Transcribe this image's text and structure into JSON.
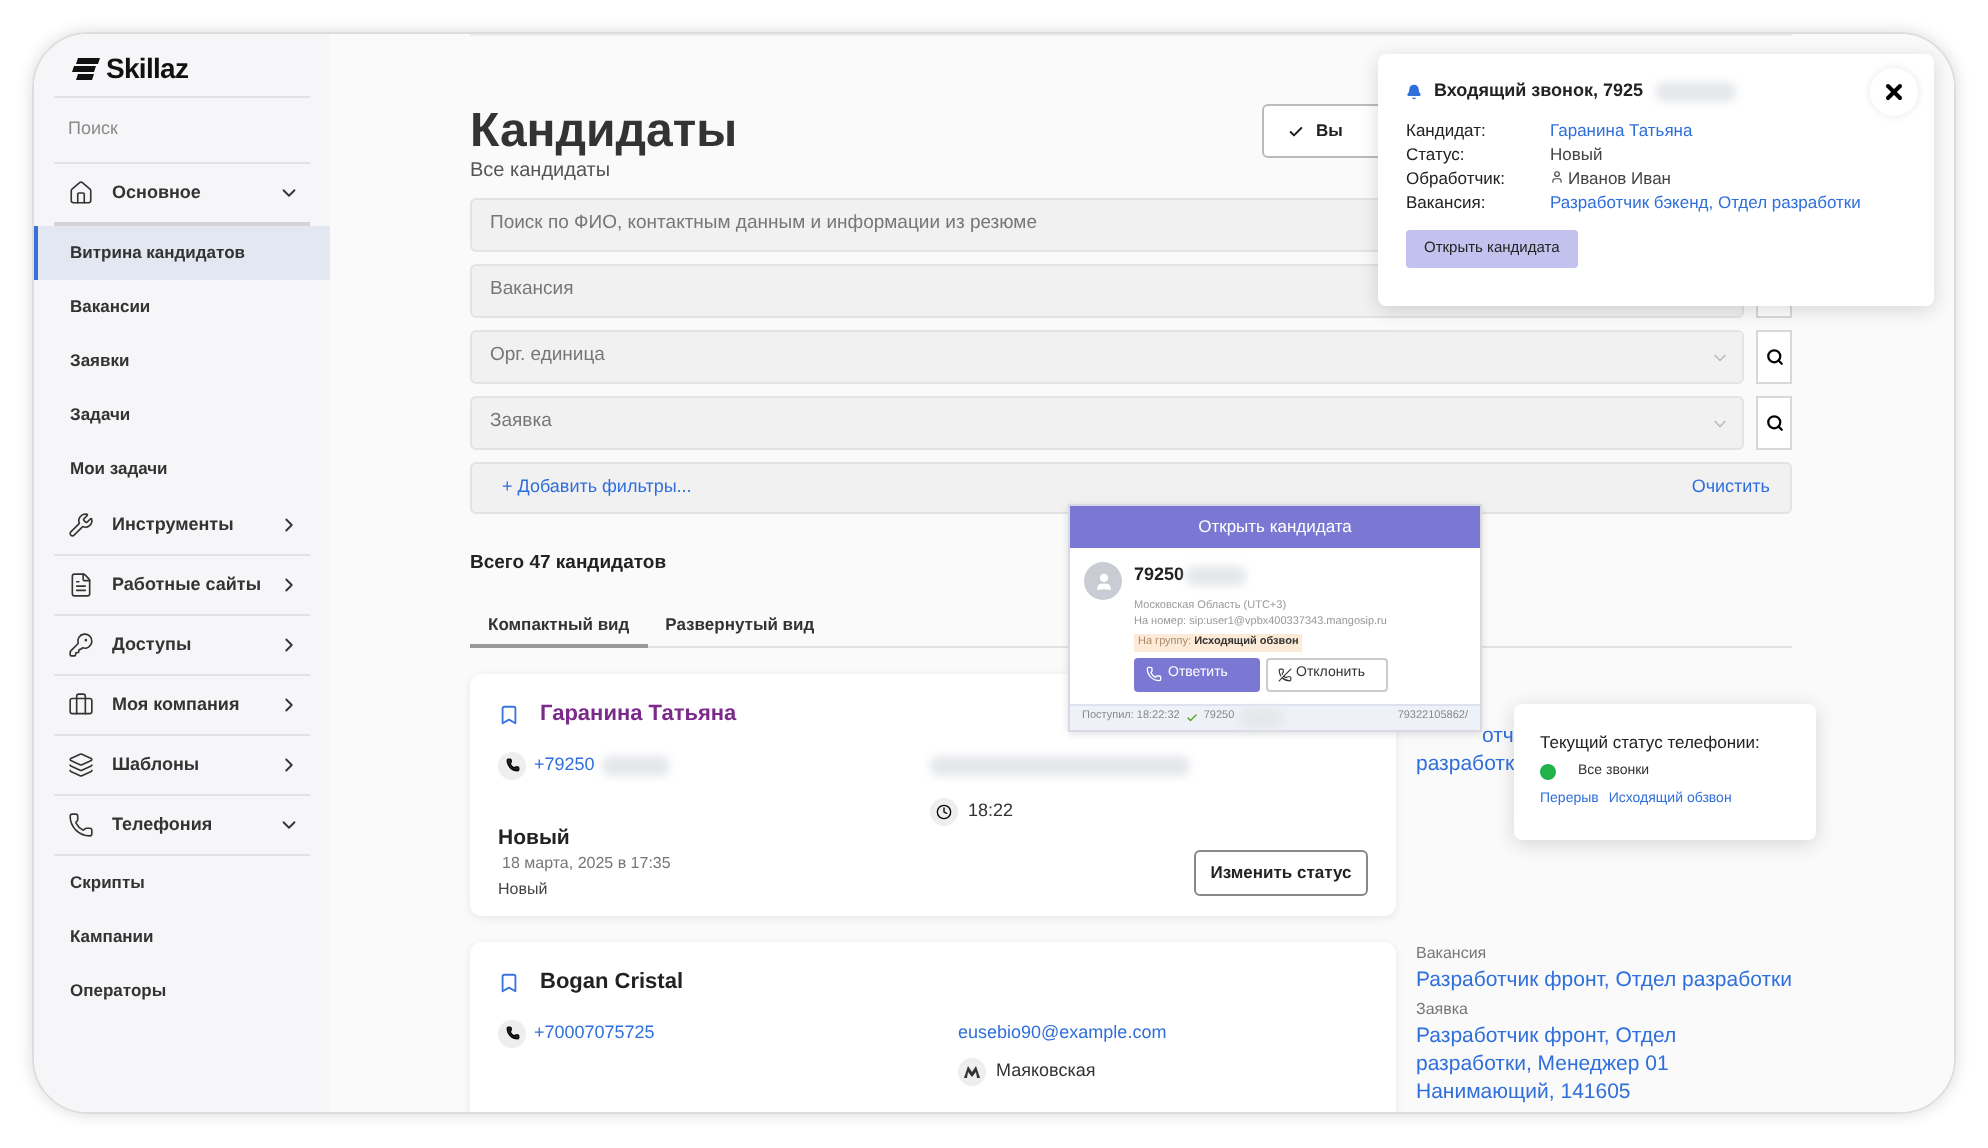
{
  "app": {
    "logo": "Skillaz"
  },
  "sidebar": {
    "search_label": "Поиск",
    "groups": [
      {
        "label": "Основное",
        "expanded": true,
        "children": [
          {
            "label": "Витрина кандидатов",
            "selected": true
          },
          {
            "label": "Вакансии",
            "selected": false
          },
          {
            "label": "Заявки",
            "selected": false
          },
          {
            "label": "Задачи",
            "selected": false
          },
          {
            "label": "Мои задачи",
            "selected": false
          }
        ]
      },
      {
        "label": "Инструменты",
        "expanded": false
      },
      {
        "label": "Работные сайты",
        "expanded": false
      },
      {
        "label": "Доступы",
        "expanded": false
      },
      {
        "label": "Моя компания",
        "expanded": false
      },
      {
        "label": "Шаблоны",
        "expanded": false
      },
      {
        "label": "Телефония",
        "expanded": true,
        "children": [
          {
            "label": "Скрипты",
            "selected": false
          },
          {
            "label": "Кампании",
            "selected": false
          },
          {
            "label": "Операторы",
            "selected": false
          }
        ]
      }
    ]
  },
  "page": {
    "title": "Кандидаты",
    "subtitle": "Все кандидаты",
    "top_button": "Вы",
    "search": {
      "placeholder": "Поиск по ФИО, контактным данным и информации из резюме"
    },
    "filters": [
      {
        "placeholder": "Вакансия"
      },
      {
        "placeholder": "Орг. единица"
      },
      {
        "placeholder": "Заявка"
      }
    ],
    "add_filters": "+ Добавить фильтры...",
    "clear": "Очистить",
    "total": "Всего 47 кандидатов",
    "view_tabs": [
      {
        "label": "Компактный вид",
        "selected": true
      },
      {
        "label": "Развернутый вид",
        "selected": false
      }
    ]
  },
  "candidates": [
    {
      "name": "Гаранина Татьяна",
      "viewed": true,
      "phone": "+79250",
      "time": "18:22",
      "status": "Новый",
      "status_date": "18 марта, 2025 в 17:35",
      "stage": "Новый",
      "button": "Изменить статус",
      "side_lines": [
        "отч",
        "разработк"
      ]
    },
    {
      "name": "Bogan Cristal",
      "viewed": false,
      "phone": "+70007075725",
      "email": "eusebio90@example.com",
      "metro": "Маяковская",
      "side": [
        {
          "label": "Вакансия",
          "value": "Разработчик фронт, Отдел разработки"
        },
        {
          "label": "Заявка",
          "value": "Разработчик фронт, Отдел разработки, Менеджер 01 Нанимающий, 141605"
        }
      ]
    }
  ],
  "softphone": {
    "header_button": "Открыть кандидата",
    "number": "79250",
    "region": "Московская Область (UTC+3)",
    "to_number": "На номер: sip:user1@vpbx400337343.mangosip.ru",
    "group_label": "На группу:",
    "group": "Исходящий обзвон",
    "answer": "Ответить",
    "decline": "Отклонить",
    "received": "Поступил: 18:22:32",
    "footer_number": "79250",
    "footer_right": "79322105862/"
  },
  "call_popup": {
    "title": "Входящий звонок, 7925",
    "fields": [
      {
        "label": "Кандидат:",
        "value": "Гаранина Татьяна",
        "kind": "link"
      },
      {
        "label": "Статус:",
        "value": "Новый",
        "kind": "text"
      },
      {
        "label": "Обработчик:",
        "value": "Иванов Иван",
        "kind": "user"
      },
      {
        "label": "Вакансия:",
        "value": "Разработчик бэкенд, Отдел разработки",
        "kind": "link"
      }
    ],
    "button": "Открыть кандидата"
  },
  "telephony_status": {
    "title": "Текущий статус телефонии:",
    "current": {
      "label": "Все звонки",
      "color": "#22b24c"
    },
    "actions": [
      "Перерыв",
      "Исходящий обзвон"
    ]
  }
}
